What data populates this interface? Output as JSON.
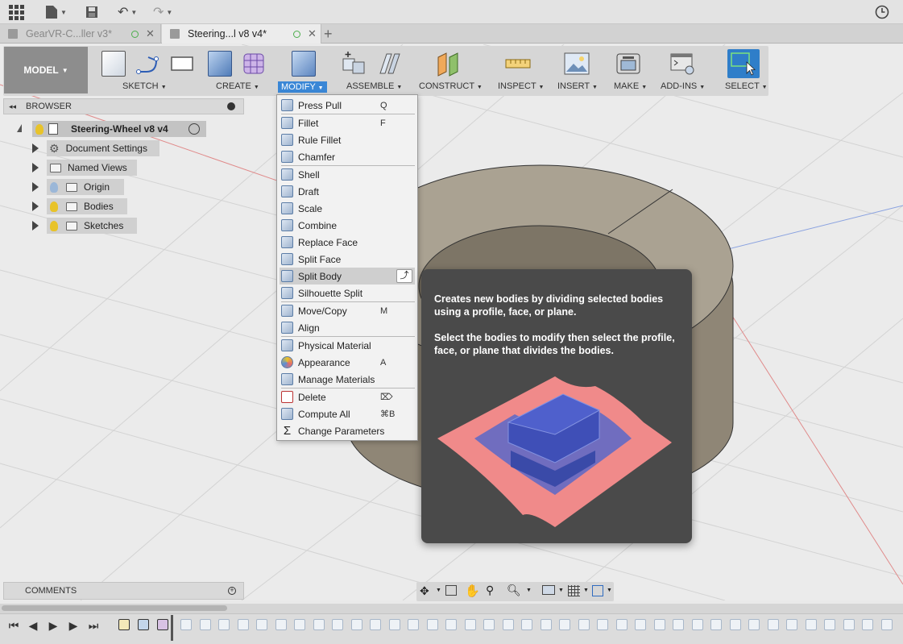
{
  "tabs": [
    {
      "label": "GearVR-C...ller v3*",
      "active": false
    },
    {
      "label": "Steering...l v8 v4*",
      "active": true
    }
  ],
  "toolbar": {
    "model_label": "MODEL",
    "groups": [
      "SKETCH",
      "CREATE",
      "MODIFY",
      "ASSEMBLE",
      "CONSTRUCT",
      "INSPECT",
      "INSERT",
      "MAKE",
      "ADD-INS",
      "SELECT"
    ],
    "active_group": "MODIFY"
  },
  "browser": {
    "title": "BROWSER",
    "root": "Steering-Wheel v8 v4",
    "items": [
      "Document Settings",
      "Named Views",
      "Origin",
      "Bodies",
      "Sketches"
    ]
  },
  "comments_label": "COMMENTS",
  "menu": {
    "items": [
      {
        "label": "Press Pull",
        "shortcut": "Q"
      },
      {
        "label": "Fillet",
        "shortcut": "F"
      },
      {
        "label": "Rule Fillet",
        "shortcut": ""
      },
      {
        "label": "Chamfer",
        "shortcut": ""
      },
      {
        "label": "Shell",
        "shortcut": ""
      },
      {
        "label": "Draft",
        "shortcut": ""
      },
      {
        "label": "Scale",
        "shortcut": ""
      },
      {
        "label": "Combine",
        "shortcut": ""
      },
      {
        "label": "Replace Face",
        "shortcut": ""
      },
      {
        "label": "Split Face",
        "shortcut": ""
      },
      {
        "label": "Split Body",
        "shortcut": ""
      },
      {
        "label": "Silhouette Split",
        "shortcut": ""
      },
      {
        "label": "Move/Copy",
        "shortcut": "M"
      },
      {
        "label": "Align",
        "shortcut": ""
      },
      {
        "label": "Physical Material",
        "shortcut": ""
      },
      {
        "label": "Appearance",
        "shortcut": "A"
      },
      {
        "label": "Manage Materials",
        "shortcut": ""
      },
      {
        "label": "Delete",
        "shortcut": "⌦"
      },
      {
        "label": "Compute All",
        "shortcut": "⌘B"
      },
      {
        "label": "Change Parameters",
        "shortcut": ""
      }
    ],
    "highlighted": "Split Body"
  },
  "tooltip": {
    "line1": "Creates new bodies by dividing selected bodies using a profile, face, or plane.",
    "line2": "Select the bodies to modify then select the profile, face, or plane that divides the bodies."
  },
  "colors": {
    "accent": "#3a87d6",
    "tooltip_bg": "#4a4a4a",
    "model_body": "#8f8676",
    "split_plane": "#f08a8a",
    "split_body": "#3f4fb7"
  }
}
